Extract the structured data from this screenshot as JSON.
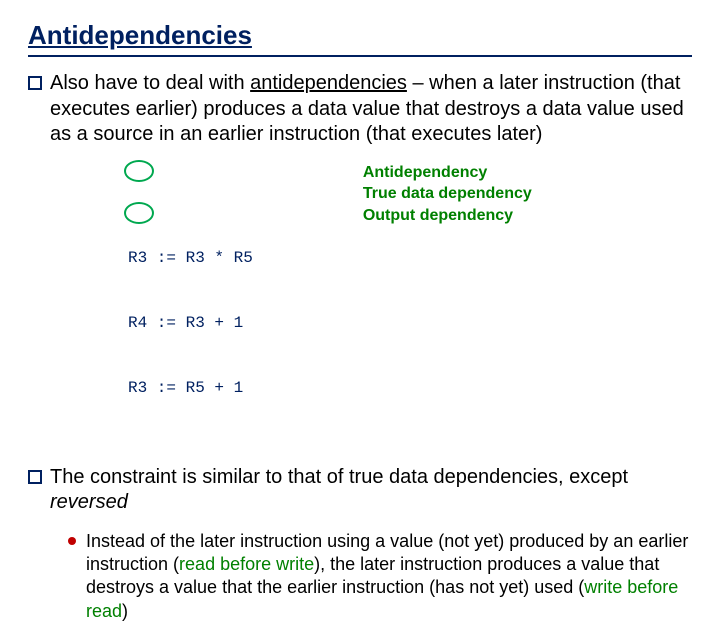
{
  "title": "Antidependencies",
  "p1": {
    "lead": "Also have to deal with ",
    "kw": "antidependencies",
    "rest": " – when a later instruction (that executes earlier) produces a data value that destroys a data value used as a source in an earlier instruction (that executes later)"
  },
  "code": {
    "l1": "R3 := R3 * R5",
    "l2": "R4 := R3 + 1",
    "l3": "R3 := R5 + 1"
  },
  "deps": {
    "d1": "Antidependency",
    "d2": "True data dependency",
    "d3": "Output dependency"
  },
  "p2": {
    "lead": "The constraint is similar to that of true data dependencies, except ",
    "kw": "reversed"
  },
  "p3": {
    "a": "Instead of the later instruction using a value (not yet) produced by an earlier instruction (",
    "rbw": "read before write",
    "b": "), the later instruction produces a value that destroys a value that the earlier instruction (has not yet) used (",
    "wbr": "write before read",
    "c": ")"
  }
}
